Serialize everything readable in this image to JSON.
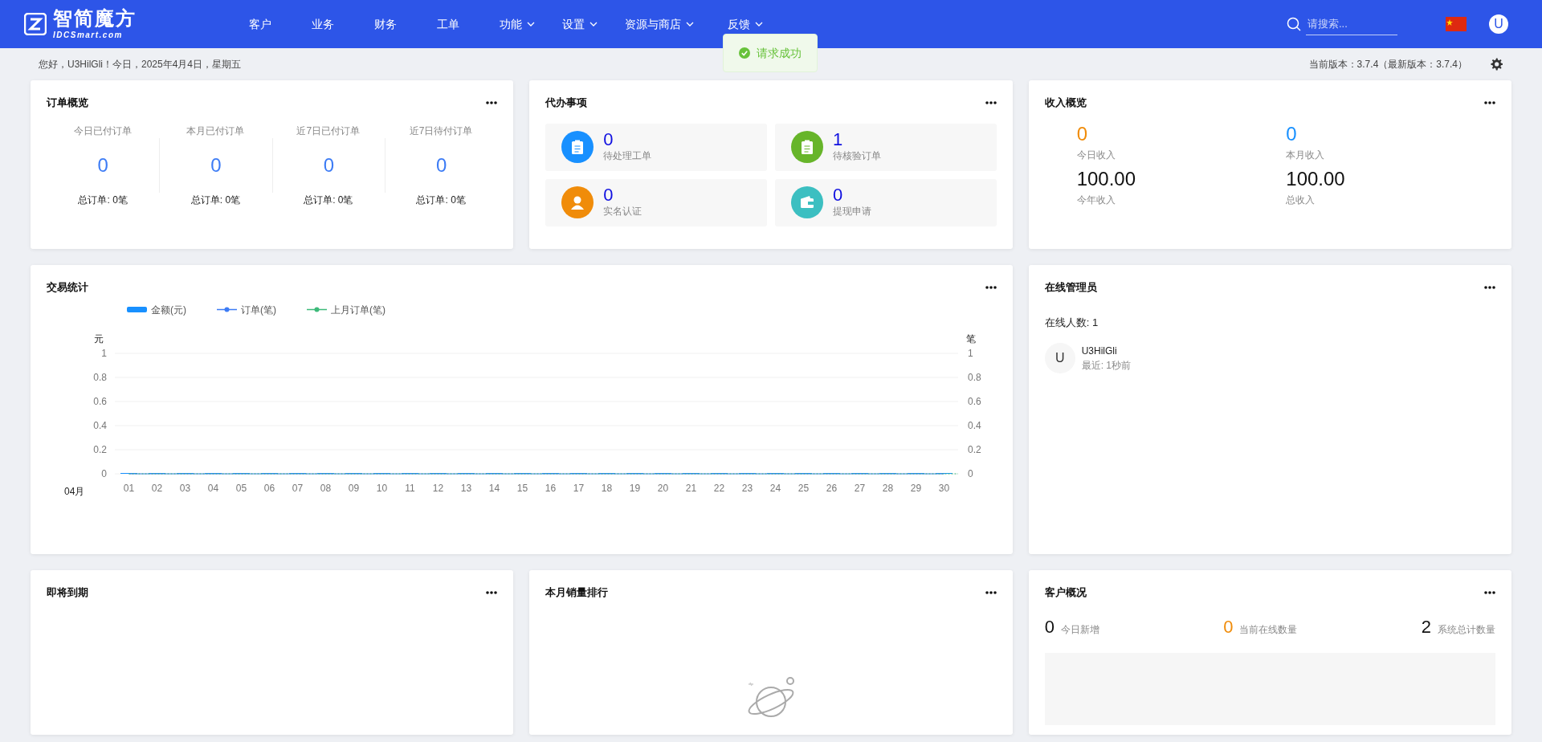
{
  "header": {
    "logo": {
      "name": "智简魔方",
      "domain": "IDCSmart.com"
    },
    "nav": [
      {
        "label": "客户",
        "has_menu": false
      },
      {
        "label": "业务",
        "has_menu": false
      },
      {
        "label": "财务",
        "has_menu": false
      },
      {
        "label": "工单",
        "has_menu": false
      },
      {
        "label": "功能",
        "has_menu": true
      },
      {
        "label": "设置",
        "has_menu": true
      },
      {
        "label": "资源与商店",
        "has_menu": true
      },
      {
        "label": "反馈",
        "has_menu": true
      }
    ],
    "search": {
      "placeholder": "请搜索..."
    },
    "avatar": "U"
  },
  "toast": {
    "message": "请求成功"
  },
  "subbar": {
    "greeting": "您好，U3HilGli！今日，2025年4月4日，星期五",
    "version": "当前版本：3.7.4（最新版本：3.7.4）"
  },
  "order_overview": {
    "title": "订单概览",
    "stats": [
      {
        "label": "今日已付订单",
        "value": "0",
        "total": "总订单: 0笔"
      },
      {
        "label": "本月已付订单",
        "value": "0",
        "total": "总订单: 0笔"
      },
      {
        "label": "近7日已付订单",
        "value": "0",
        "total": "总订单: 0笔"
      },
      {
        "label": "近7日待付订单",
        "value": "0",
        "total": "总订单: 0笔"
      }
    ]
  },
  "todo": {
    "title": "代办事项",
    "items": [
      {
        "value": "0",
        "label": "待处理工单",
        "color": "#1890ff"
      },
      {
        "value": "1",
        "label": "待核验订单",
        "color": "#67b52a"
      },
      {
        "value": "0",
        "label": "实名认证",
        "color": "#f08c0a"
      },
      {
        "value": "0",
        "label": "提现申请",
        "color": "#3cbfc1"
      }
    ]
  },
  "income": {
    "title": "收入概览",
    "items": [
      {
        "value": "0",
        "label": "今日收入",
        "color": "#f08c0a"
      },
      {
        "value": "0",
        "label": "本月收入",
        "color": "#1890ff"
      },
      {
        "value": "100.00",
        "label": "今年收入",
        "color": "#111111"
      },
      {
        "value": "100.00",
        "label": "总收入",
        "color": "#111111"
      }
    ]
  },
  "transactions": {
    "title": "交易统计",
    "month": "04月",
    "chart_data": {
      "type": "bar",
      "categories": [
        "01",
        "02",
        "03",
        "04",
        "05",
        "06",
        "07",
        "08",
        "09",
        "10",
        "11",
        "12",
        "13",
        "14",
        "15",
        "16",
        "17",
        "18",
        "19",
        "20",
        "21",
        "22",
        "23",
        "24",
        "25",
        "26",
        "27",
        "28",
        "29",
        "30"
      ],
      "ylabel": "元",
      "y2label": "笔",
      "ylim": [
        0,
        1
      ],
      "yticks": [
        0,
        0.2,
        0.4,
        0.6,
        0.8,
        1
      ],
      "y2lim": [
        0,
        1
      ],
      "y2ticks": [
        0,
        0.2,
        0.4,
        0.6,
        0.8,
        1
      ],
      "grid": true,
      "series": [
        {
          "name": "金额(元)",
          "color": "#1890ff",
          "values": [
            0,
            0,
            0,
            0,
            0,
            0,
            0,
            0,
            0,
            0,
            0,
            0,
            0,
            0,
            0,
            0,
            0,
            0,
            0,
            0,
            0,
            0,
            0,
            0,
            0,
            0,
            0,
            0,
            0,
            0
          ]
        },
        {
          "name": "订单(笔)",
          "color": "#3d7cf5",
          "values": [
            0,
            0,
            0,
            0,
            0,
            0,
            0,
            0,
            0,
            0,
            0,
            0,
            0,
            0,
            0,
            0,
            0,
            0,
            0,
            0,
            0,
            0,
            0,
            0,
            0,
            0,
            0,
            0,
            0,
            0
          ]
        },
        {
          "name": "上月订单(笔)",
          "color": "#3dba7a",
          "values": [
            0,
            0,
            0,
            0,
            0,
            0,
            0,
            0,
            0,
            0,
            0,
            0,
            0,
            0,
            0,
            0,
            0,
            0,
            0,
            0,
            0,
            0,
            0,
            0,
            0,
            0,
            0,
            0,
            0,
            0
          ]
        }
      ]
    }
  },
  "online_admins": {
    "title": "在线管理员",
    "count": "在线人数: 1",
    "admins": [
      {
        "avatar": "U",
        "name": "U3HilGli",
        "last_seen": "最近: 1秒前"
      }
    ]
  },
  "expiring": {
    "title": "即将到期"
  },
  "sales_rank": {
    "title": "本月销量排行"
  },
  "customers": {
    "title": "客户概况",
    "stats": [
      {
        "value": "0",
        "label": "今日新增",
        "color": "#111111"
      },
      {
        "value": "0",
        "label": "当前在线数量",
        "color": "#f08c0a"
      },
      {
        "value": "2",
        "label": "系统总计数量",
        "color": "#111111"
      }
    ]
  }
}
